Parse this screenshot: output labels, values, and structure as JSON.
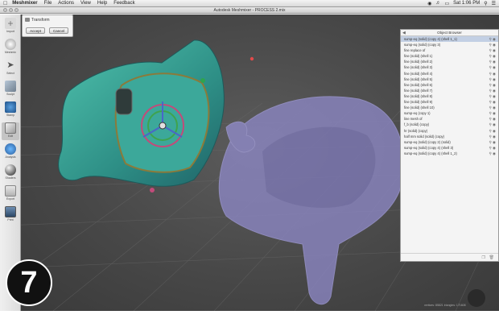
{
  "menubar": {
    "app_name": "Meshmixer",
    "menus": [
      "File",
      "Actions",
      "View",
      "Help",
      "Feedback"
    ],
    "clock": "Sat 1:06 PM"
  },
  "window": {
    "title": "Autodesk Meshmixer - PROCESS 2.mix"
  },
  "toolbar": {
    "tools": [
      {
        "label": "Import",
        "icon": "plus-icon"
      },
      {
        "label": "Meshmix",
        "icon": "meshmix-icon"
      },
      {
        "label": "Select",
        "icon": "select-arrow-icon"
      },
      {
        "label": "Sculpt",
        "icon": "brush-icon"
      },
      {
        "label": "Stamp",
        "icon": "stamp-icon"
      },
      {
        "label": "Edit",
        "icon": "edit-icon"
      },
      {
        "label": "Analysis",
        "icon": "globe-icon"
      },
      {
        "label": "Shaders",
        "icon": "sphere-icon"
      },
      {
        "label": "Export",
        "icon": "export-icon"
      },
      {
        "label": "Print",
        "icon": "print-icon"
      }
    ]
  },
  "transform_panel": {
    "title": "Transform",
    "accept_label": "Accept",
    "cancel_label": "Cancel"
  },
  "object_browser": {
    "title": "Object Browser",
    "items": [
      "sump-eq (solid) (copy 4) (shell 1_1)",
      "sump-eq (solid) (copy 3)",
      "fine replace of",
      "fine (solid) (shell 1)",
      "fine (solid) (shell 2)",
      "fine (solid) (shell 3)",
      "fine (solid) (shell 4)",
      "fine (solid) (shell 5)",
      "fine (solid) (shell 6)",
      "fine (solid) (shell 7)",
      "fine (solid) (shell 8)",
      "fine (solid) (shell 9)",
      "fine (solid) (shell 10)",
      "sump-eq (copy 1)",
      "line mesh of",
      "f_b (solid) (copy)",
      "hr (solid) (copy)",
      "half mm solid (solid) (copy)",
      "sump-eq (solid) (copy 2) (solid)",
      "sump-eq (solid) (copy 4) (shell 3)",
      "sump-eq (solid) (copy 4) (shell 1_2)"
    ],
    "selected_index": 0
  },
  "status_text": "vertices: 85821 triangles: 171608",
  "step_number": "7"
}
